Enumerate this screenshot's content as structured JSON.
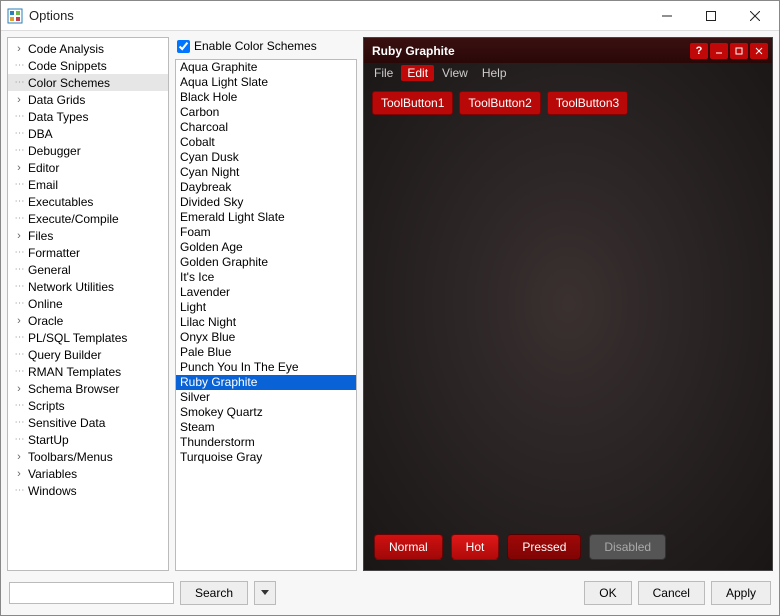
{
  "window": {
    "title": "Options"
  },
  "tree": {
    "items": [
      {
        "label": "Code Analysis",
        "expandable": true
      },
      {
        "label": "Code Snippets",
        "expandable": false
      },
      {
        "label": "Color Schemes",
        "expandable": false,
        "selected": true
      },
      {
        "label": "Data Grids",
        "expandable": true
      },
      {
        "label": "Data Types",
        "expandable": false
      },
      {
        "label": "DBA",
        "expandable": false
      },
      {
        "label": "Debugger",
        "expandable": false
      },
      {
        "label": "Editor",
        "expandable": true
      },
      {
        "label": "Email",
        "expandable": false
      },
      {
        "label": "Executables",
        "expandable": false
      },
      {
        "label": "Execute/Compile",
        "expandable": false
      },
      {
        "label": "Files",
        "expandable": true
      },
      {
        "label": "Formatter",
        "expandable": false
      },
      {
        "label": "General",
        "expandable": false
      },
      {
        "label": "Network Utilities",
        "expandable": false
      },
      {
        "label": "Online",
        "expandable": false
      },
      {
        "label": "Oracle",
        "expandable": true
      },
      {
        "label": "PL/SQL Templates",
        "expandable": false
      },
      {
        "label": "Query Builder",
        "expandable": false
      },
      {
        "label": "RMAN Templates",
        "expandable": false
      },
      {
        "label": "Schema Browser",
        "expandable": true
      },
      {
        "label": "Scripts",
        "expandable": false
      },
      {
        "label": "Sensitive Data",
        "expandable": false
      },
      {
        "label": "StartUp",
        "expandable": false
      },
      {
        "label": "Toolbars/Menus",
        "expandable": true
      },
      {
        "label": "Variables",
        "expandable": true
      },
      {
        "label": "Windows",
        "expandable": false
      }
    ]
  },
  "colorSchemes": {
    "enableLabel": "Enable Color Schemes",
    "enabled": true,
    "items": [
      "Aqua Graphite",
      "Aqua Light Slate",
      "Black Hole",
      "Carbon",
      "Charcoal",
      "Cobalt",
      "Cyan Dusk",
      "Cyan Night",
      "Daybreak",
      "Divided Sky",
      "Emerald Light Slate",
      "Foam",
      "Golden Age",
      "Golden Graphite",
      "It's Ice",
      "Lavender",
      "Light",
      "Lilac Night",
      "Onyx Blue",
      "Pale Blue",
      "Punch You In The Eye",
      "Ruby Graphite",
      "Silver",
      "Smokey Quartz",
      "Steam",
      "Thunderstorm",
      "Turquoise Gray"
    ],
    "selected": "Ruby Graphite"
  },
  "preview": {
    "title": "Ruby Graphite",
    "menus": [
      "File",
      "Edit",
      "View",
      "Help"
    ],
    "activeMenu": "Edit",
    "toolButtons": [
      "ToolButton1",
      "ToolButton2",
      "ToolButton3"
    ],
    "states": {
      "normal": "Normal",
      "hot": "Hot",
      "pressed": "Pressed",
      "disabled": "Disabled"
    }
  },
  "buttons": {
    "search": "Search",
    "ok": "OK",
    "cancel": "Cancel",
    "apply": "Apply"
  },
  "search": {
    "value": ""
  }
}
